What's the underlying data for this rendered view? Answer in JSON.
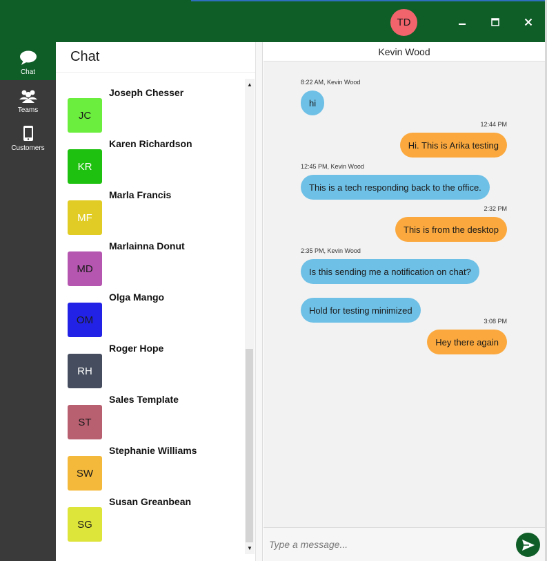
{
  "titlebar": {
    "user_initials": "TD",
    "user_avatar_color": "#f2646c",
    "brand_color": "#0f5e28"
  },
  "nav": {
    "items": [
      {
        "label": "Chat",
        "icon": "chat-bubble-icon",
        "active": true
      },
      {
        "label": "Teams",
        "icon": "people-group-icon",
        "active": false
      },
      {
        "label": "Customers",
        "icon": "mobile-phone-icon",
        "active": false
      }
    ]
  },
  "contacts": {
    "title": "Chat",
    "items": [
      {
        "initials": "JC",
        "name": "Joseph Chesser",
        "color": "#6cee3e",
        "text_color": "#1a1a1a"
      },
      {
        "initials": "KR",
        "name": "Karen Richardson",
        "color": "#1fc110",
        "text_color": "#ffffff"
      },
      {
        "initials": "MF",
        "name": "Marla Francis",
        "color": "#e0cc24",
        "text_color": "#ffffff"
      },
      {
        "initials": "MD",
        "name": "Marlainna Donut",
        "color": "#b556b0",
        "text_color": "#1a1a1a"
      },
      {
        "initials": "OM",
        "name": "Olga Mango",
        "color": "#2222e6",
        "text_color": "#1a1a1a"
      },
      {
        "initials": "RH",
        "name": "Roger Hope",
        "color": "#454d5e",
        "text_color": "#ffffff"
      },
      {
        "initials": "ST",
        "name": "Sales Template",
        "color": "#b85f70",
        "text_color": "#1a1a1a"
      },
      {
        "initials": "SW",
        "name": "Stephanie Williams",
        "color": "#f4b93a",
        "text_color": "#1a1a1a"
      },
      {
        "initials": "SG",
        "name": "Susan Greanbean",
        "color": "#dde43a",
        "text_color": "#1a1a1a"
      }
    ]
  },
  "chat": {
    "contact_name": "Kevin Wood",
    "messages": [
      {
        "direction": "in",
        "meta": "8:22 AM, Kevin Wood",
        "text": "hi"
      },
      {
        "direction": "out",
        "meta": "12:44 PM",
        "text": "Hi.  This is Arika testing"
      },
      {
        "direction": "in",
        "meta": "12:45 PM, Kevin Wood",
        "text": "This is a tech responding back to the office."
      },
      {
        "direction": "out",
        "meta": "2:32 PM",
        "text": "This is from the desktop"
      },
      {
        "direction": "in",
        "meta": "2:35 PM, Kevin Wood",
        "text": "Is this sending me a notification on chat?"
      },
      {
        "direction": "in",
        "meta": "",
        "text": "Hold for testing minimized"
      },
      {
        "direction": "out",
        "meta": "3:08 PM",
        "text": "Hey there again"
      }
    ],
    "incoming_color": "#6fc0e6",
    "outgoing_color": "#fba93e",
    "input_placeholder": "Type a message..."
  }
}
